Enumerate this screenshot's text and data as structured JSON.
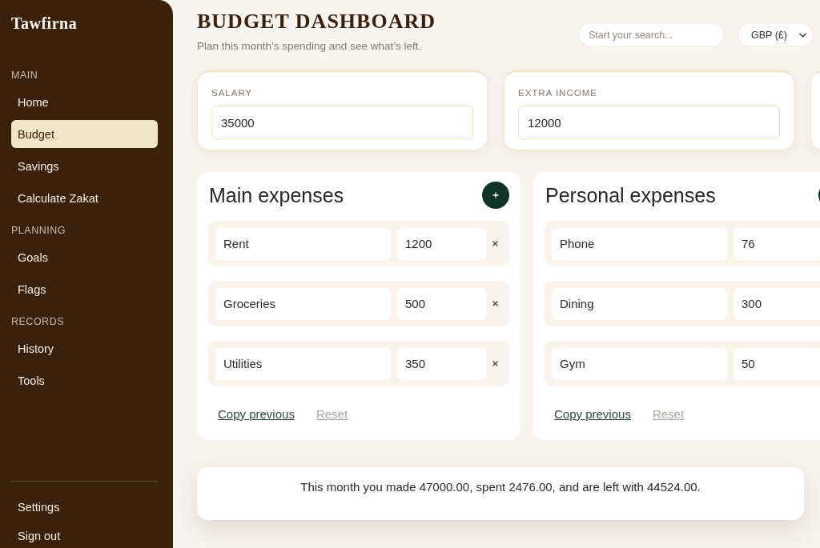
{
  "sidebar": {
    "brand": "Tawfirna",
    "sections": [
      {
        "heading": "MAIN",
        "items": [
          {
            "label": "Home",
            "selected": false
          },
          {
            "label": "Budget",
            "selected": true
          },
          {
            "label": "Savings",
            "selected": false
          },
          {
            "label": "Calculate Zakat",
            "selected": false
          }
        ]
      },
      {
        "heading": "PLANNING",
        "items": [
          {
            "label": "Goals",
            "selected": false
          },
          {
            "label": "Flags",
            "selected": false
          }
        ]
      },
      {
        "heading": "RECORDS",
        "items": [
          {
            "label": "History",
            "selected": false
          },
          {
            "label": "Tools",
            "selected": false
          }
        ]
      }
    ],
    "footer_items": [
      {
        "label": "Settings",
        "selected": false
      },
      {
        "label": "Sign out",
        "selected": false
      }
    ]
  },
  "header": {
    "title": "BUDGET DASHBOARD",
    "subtitle": "Plan this month’s spending and see what’s left.",
    "search": {
      "placeholder": "Start your search..."
    },
    "currency": {
      "value": "GBP (£)"
    }
  },
  "income": [
    {
      "label": "SALARY",
      "value": "35000"
    },
    {
      "label": "EXTRA INCOME",
      "value": "12000"
    }
  ],
  "expense_groups": [
    {
      "title": "Main expenses",
      "items": [
        {
          "name": "Rent",
          "amount": "1200"
        },
        {
          "name": "Groceries",
          "amount": "500"
        },
        {
          "name": "Utilities",
          "amount": "350"
        }
      ],
      "actions": [
        {
          "label": "Copy previous",
          "disabled": false
        },
        {
          "label": "Reset",
          "disabled": true
        }
      ]
    },
    {
      "title": "Personal expenses",
      "items": [
        {
          "name": "Phone",
          "amount": "76"
        },
        {
          "name": "Dining",
          "amount": "300"
        },
        {
          "name": "Gym",
          "amount": "50"
        }
      ],
      "actions": [
        {
          "label": "Copy previous",
          "disabled": false
        },
        {
          "label": "Reset",
          "disabled": true
        }
      ]
    }
  ],
  "summary": "This month you made 47000.00, spent 2476.00, and are left with 44524.00."
}
